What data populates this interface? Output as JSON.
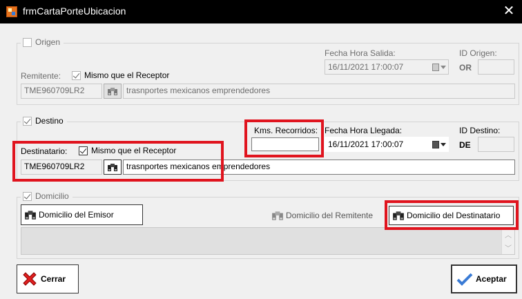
{
  "window": {
    "title": "frmCartaPorteUbicacion"
  },
  "origen": {
    "legend": "Origen",
    "checked": false,
    "fecha_label": "Fecha Hora Salida:",
    "fecha_value": "16/11/2021 17:00:07",
    "id_label": "ID Origen:",
    "id_prefix": "OR",
    "id_value": "",
    "remitente_label": "Remitente:",
    "mismo_label": "Mismo que el Receptor",
    "mismo_checked": true,
    "rfc": "TME960709LR2",
    "nombre": "trasnportes mexicanos emprendedores"
  },
  "destino": {
    "legend": "Destino",
    "checked": true,
    "kms_label": "Kms. Recorridos:",
    "kms_value": "",
    "fecha_label": "Fecha Hora Llegada:",
    "fecha_value": "16/11/2021 17:00:07",
    "id_label": "ID Destino:",
    "id_prefix": "DE",
    "id_value": "",
    "destinatario_label": "Destinatario:",
    "mismo_label": "Mismo que el Receptor",
    "mismo_checked": true,
    "rfc": "TME960709LR2",
    "nombre": "trasnportes mexicanos emprendedores"
  },
  "domicilio": {
    "legend": "Domicilio",
    "checked": true,
    "emisor_label": "Domicilio del Emisor",
    "remitente_label": "Domicilio del Remitente",
    "destinatario_label": "Domicilio del Destinatario",
    "text": ""
  },
  "footer": {
    "cerrar_label": "Cerrar",
    "aceptar_label": "Aceptar"
  },
  "colors": {
    "highlight": "#e0141e",
    "titlebar": "#000000",
    "background": "#f0f0f0"
  },
  "icons": {
    "app": "form-icon",
    "close": "close-icon",
    "search": "binoculars-icon",
    "calendar": "calendar-icon",
    "cancel": "red-x-icon",
    "accept": "checkmark-icon"
  }
}
